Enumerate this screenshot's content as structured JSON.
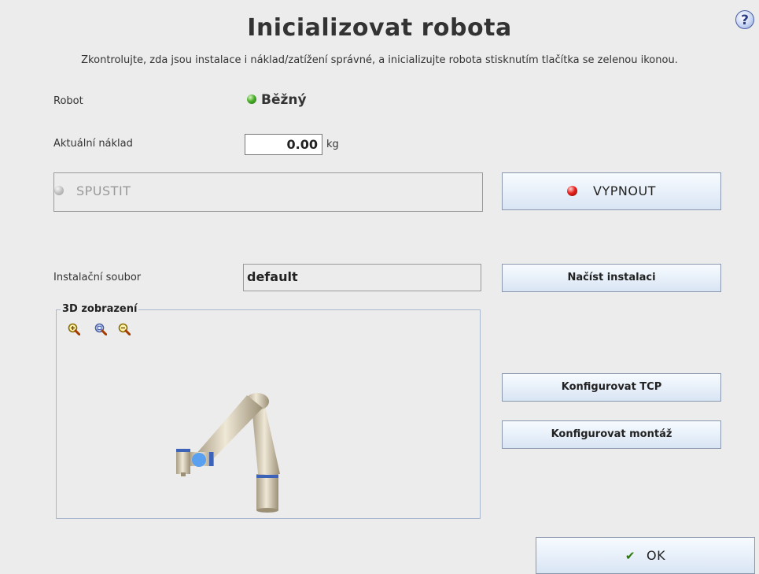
{
  "header": {
    "title": "Inicializovat robota",
    "subtitle": "Zkontrolujte, zda jsou instalace i náklad/zatížení správné, a inicializujte robota stisknutím tlačítka se zelenou ikonou.",
    "help_icon": "?"
  },
  "robot": {
    "label": "Robot",
    "status": "Běžný",
    "status_color": "#3aa022"
  },
  "payload": {
    "label": "Aktuální náklad",
    "value": "0.00",
    "unit": "kg"
  },
  "buttons": {
    "start": "SPUSTIT",
    "power_off": "VYPNOUT",
    "load_installation": "Načíst instalaci",
    "configure_tcp": "Konfigurovat TCP",
    "configure_mount": "Konfigurovat montáž",
    "ok": "OK"
  },
  "installation": {
    "label": "Instalační soubor",
    "file": "default"
  },
  "view3d": {
    "title": "3D zobrazení",
    "icons": [
      "zoom-in-icon",
      "zoom-fit-icon",
      "zoom-out-icon"
    ]
  },
  "colors": {
    "status_green": "#3aa022",
    "power_red": "#e8211c",
    "button_top": "#f7fbff",
    "button_bottom": "#d9e5f4"
  }
}
